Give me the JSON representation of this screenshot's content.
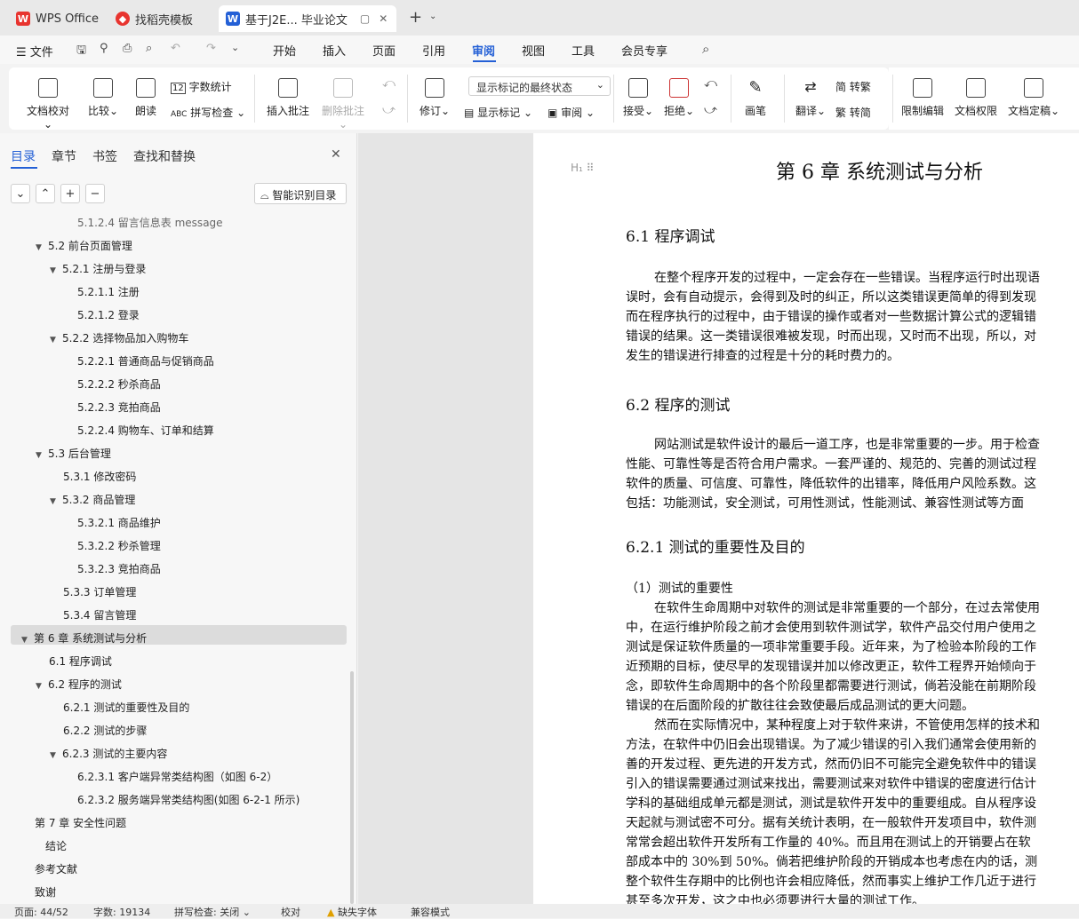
{
  "tabs": [
    {
      "label": "WPS Office"
    },
    {
      "label": "找稻壳模板"
    },
    {
      "label": "基于J2E... 毕业论文"
    }
  ],
  "menu": {
    "file": "文件",
    "items": [
      "开始",
      "插入",
      "页面",
      "引用",
      "审阅",
      "视图",
      "工具",
      "会员专享"
    ]
  },
  "ribbon": {
    "doc_check": "文档校对",
    "compare": "比较",
    "read_aloud": "朗读",
    "word_count": "字数统计",
    "spell_check": "拼写检查",
    "insert_comment": "插入批注",
    "delete_comment": "删除批注",
    "revise": "修订",
    "markup_combo": "显示标记的最终状态",
    "show_markup": "显示标记",
    "review": "审阅",
    "accept": "接受",
    "reject": "拒绝",
    "pen": "画笔",
    "translate": "翻译",
    "to_traditional": "转繁",
    "to_simplified": "转简",
    "restrict_edit": "限制编辑",
    "doc_permission": "文档权限",
    "doc_finalize": "文档定稿"
  },
  "panel": {
    "tabs": [
      "目录",
      "章节",
      "书签",
      "查找和替换"
    ],
    "smart_toc": "智能识别目录",
    "toc": [
      {
        "text": "5.1.2.4    留言信息表 message"
      },
      {
        "text": "5.2    前台页面管理"
      },
      {
        "text": "5.2.1    注册与登录"
      },
      {
        "text": "5.2.1.1    注册"
      },
      {
        "text": "5.2.1.2    登录"
      },
      {
        "text": "5.2.2    选择物品加入购物车"
      },
      {
        "text": "5.2.2.1    普通商品与促销商品"
      },
      {
        "text": "5.2.2.2    秒杀商品"
      },
      {
        "text": "5.2.2.3    竞拍商品"
      },
      {
        "text": "5.2.2.4    购物车、订单和结算"
      },
      {
        "text": "5.3    后台管理"
      },
      {
        "text": "5.3.1    修改密码"
      },
      {
        "text": "5.3.2    商品管理"
      },
      {
        "text": "5.3.2.1    商品维护"
      },
      {
        "text": "5.3.2.2    秒杀管理"
      },
      {
        "text": "5.3.2.3    竞拍商品"
      },
      {
        "text": "5.3.3    订单管理"
      },
      {
        "text": "5.3.4    留言管理"
      },
      {
        "text": "第 6 章    系统测试与分析"
      },
      {
        "text": "6.1    程序调试"
      },
      {
        "text": "6.2    程序的测试"
      },
      {
        "text": "6.2.1    测试的重要性及目的"
      },
      {
        "text": "6.2.2    测试的步骤"
      },
      {
        "text": "6.2.3    测试的主要内容"
      },
      {
        "text": "6.2.3.1    客户端异常类结构图（如图 6-2）"
      },
      {
        "text": "6.2.3.2    服务端异常类结构图(如图 6-2-1 所示)"
      },
      {
        "text": "第 7 章    安全性问题"
      },
      {
        "text": "结论"
      },
      {
        "text": "参考文献"
      },
      {
        "text": "致谢"
      }
    ]
  },
  "doc": {
    "chapter_title": "第 6 章    系统测试与分析",
    "s61": "6.1    程序调试",
    "p61": [
      "在整个程序开发的过程中，一定会存在一些错误。当程序运行时出现语",
      "误时，会有自动提示，会得到及时的纠正，所以这类错误更简单的得到发现",
      "而在程序执行的过程中，由于错误的操作或者对一些数据计算公式的逻辑错",
      "错误的结果。这一类错误很难被发现，时而出现，又时而不出现，所以，对",
      "发生的错误进行排查的过程是十分的耗时费力的。"
    ],
    "s62": "6.2    程序的测试",
    "p62": [
      "网站测试是软件设计的最后一道工序，也是非常重要的一步。用于检查",
      "性能、可靠性等是否符合用户需求。一套严谨的、规范的、完善的测试过程",
      "软件的质量、可信度、可靠性，降低软件的出错率，降低用户风险系数。这",
      "包括：功能测试，安全测试，可用性测试，性能测试、兼容性测试等方面"
    ],
    "s621": "6.2.1    测试的重要性及目的",
    "sub1": "（1）测试的重要性",
    "p621": [
      "在软件生命周期中对软件的测试是非常重要的一个部分，在过去常使用",
      "中，在运行维护阶段之前才会使用到软件测试学，软件产品交付用户使用之",
      "测试是保证软件质量的一项非常重要手段。近年来，为了检验本阶段的工作",
      "近预期的目标，使尽早的发现错误并加以修改更正，软件工程界开始倾向于",
      "念，即软件生命周期中的各个阶段里都需要进行测试，倘若没能在前期阶段",
      "错误的在后面阶段的扩散往往会致使最后成品测试的更大问题。",
      "然而在实际情况中，某种程度上对于软件来讲，不管使用怎样的技术和",
      "方法，在软件中仍旧会出现错误。为了减少错误的引入我们通常会使用新的",
      "善的开发过程、更先进的开发方式，然而仍旧不可能完全避免软件中的错误",
      "引入的错误需要通过测试来找出，需要测试来对软件中错误的密度进行估计",
      "学科的基础组成单元都是测试，测试是软件开发中的重要组成。自从程序设",
      "天起就与测试密不可分。据有关统计表明，在一般软件开发项目中，软件测",
      "常常会超出软件开发所有工作量的 40%。而且用在测试上的开销要占在软",
      "部成本中的 30%到 50%。倘若把维护阶段的开销成本也考虑在内的话，测",
      "整个软件生存期中的比例也许会相应降低，然而事实上维护工作几近于进行",
      "甚至多次开发，这之中也必须要进行大量的测试工作。"
    ]
  },
  "status": {
    "page": "页面: 44/52",
    "words": "字数: 19134",
    "spell": "拼写检查: 关闭",
    "proof": "校对",
    "missing_font": "缺失字体",
    "compat": "兼容模式"
  },
  "colors": {
    "accent": "#2460d6",
    "wps_red": "#e8342f"
  }
}
